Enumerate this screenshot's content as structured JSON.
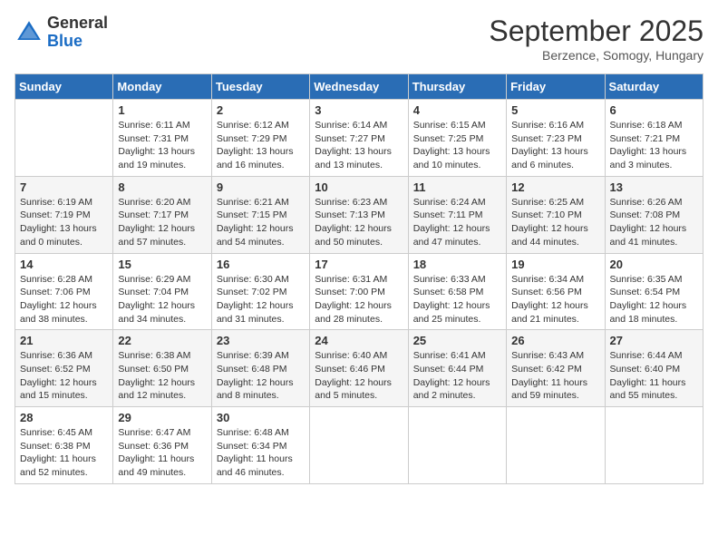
{
  "logo": {
    "general": "General",
    "blue": "Blue"
  },
  "header": {
    "month": "September 2025",
    "location": "Berzence, Somogy, Hungary"
  },
  "days_of_week": [
    "Sunday",
    "Monday",
    "Tuesday",
    "Wednesday",
    "Thursday",
    "Friday",
    "Saturday"
  ],
  "weeks": [
    [
      {
        "day": null
      },
      {
        "day": 1,
        "sunrise": "Sunrise: 6:11 AM",
        "sunset": "Sunset: 7:31 PM",
        "daylight": "Daylight: 13 hours and 19 minutes."
      },
      {
        "day": 2,
        "sunrise": "Sunrise: 6:12 AM",
        "sunset": "Sunset: 7:29 PM",
        "daylight": "Daylight: 13 hours and 16 minutes."
      },
      {
        "day": 3,
        "sunrise": "Sunrise: 6:14 AM",
        "sunset": "Sunset: 7:27 PM",
        "daylight": "Daylight: 13 hours and 13 minutes."
      },
      {
        "day": 4,
        "sunrise": "Sunrise: 6:15 AM",
        "sunset": "Sunset: 7:25 PM",
        "daylight": "Daylight: 13 hours and 10 minutes."
      },
      {
        "day": 5,
        "sunrise": "Sunrise: 6:16 AM",
        "sunset": "Sunset: 7:23 PM",
        "daylight": "Daylight: 13 hours and 6 minutes."
      },
      {
        "day": 6,
        "sunrise": "Sunrise: 6:18 AM",
        "sunset": "Sunset: 7:21 PM",
        "daylight": "Daylight: 13 hours and 3 minutes."
      }
    ],
    [
      {
        "day": 7,
        "sunrise": "Sunrise: 6:19 AM",
        "sunset": "Sunset: 7:19 PM",
        "daylight": "Daylight: 13 hours and 0 minutes."
      },
      {
        "day": 8,
        "sunrise": "Sunrise: 6:20 AM",
        "sunset": "Sunset: 7:17 PM",
        "daylight": "Daylight: 12 hours and 57 minutes."
      },
      {
        "day": 9,
        "sunrise": "Sunrise: 6:21 AM",
        "sunset": "Sunset: 7:15 PM",
        "daylight": "Daylight: 12 hours and 54 minutes."
      },
      {
        "day": 10,
        "sunrise": "Sunrise: 6:23 AM",
        "sunset": "Sunset: 7:13 PM",
        "daylight": "Daylight: 12 hours and 50 minutes."
      },
      {
        "day": 11,
        "sunrise": "Sunrise: 6:24 AM",
        "sunset": "Sunset: 7:11 PM",
        "daylight": "Daylight: 12 hours and 47 minutes."
      },
      {
        "day": 12,
        "sunrise": "Sunrise: 6:25 AM",
        "sunset": "Sunset: 7:10 PM",
        "daylight": "Daylight: 12 hours and 44 minutes."
      },
      {
        "day": 13,
        "sunrise": "Sunrise: 6:26 AM",
        "sunset": "Sunset: 7:08 PM",
        "daylight": "Daylight: 12 hours and 41 minutes."
      }
    ],
    [
      {
        "day": 14,
        "sunrise": "Sunrise: 6:28 AM",
        "sunset": "Sunset: 7:06 PM",
        "daylight": "Daylight: 12 hours and 38 minutes."
      },
      {
        "day": 15,
        "sunrise": "Sunrise: 6:29 AM",
        "sunset": "Sunset: 7:04 PM",
        "daylight": "Daylight: 12 hours and 34 minutes."
      },
      {
        "day": 16,
        "sunrise": "Sunrise: 6:30 AM",
        "sunset": "Sunset: 7:02 PM",
        "daylight": "Daylight: 12 hours and 31 minutes."
      },
      {
        "day": 17,
        "sunrise": "Sunrise: 6:31 AM",
        "sunset": "Sunset: 7:00 PM",
        "daylight": "Daylight: 12 hours and 28 minutes."
      },
      {
        "day": 18,
        "sunrise": "Sunrise: 6:33 AM",
        "sunset": "Sunset: 6:58 PM",
        "daylight": "Daylight: 12 hours and 25 minutes."
      },
      {
        "day": 19,
        "sunrise": "Sunrise: 6:34 AM",
        "sunset": "Sunset: 6:56 PM",
        "daylight": "Daylight: 12 hours and 21 minutes."
      },
      {
        "day": 20,
        "sunrise": "Sunrise: 6:35 AM",
        "sunset": "Sunset: 6:54 PM",
        "daylight": "Daylight: 12 hours and 18 minutes."
      }
    ],
    [
      {
        "day": 21,
        "sunrise": "Sunrise: 6:36 AM",
        "sunset": "Sunset: 6:52 PM",
        "daylight": "Daylight: 12 hours and 15 minutes."
      },
      {
        "day": 22,
        "sunrise": "Sunrise: 6:38 AM",
        "sunset": "Sunset: 6:50 PM",
        "daylight": "Daylight: 12 hours and 12 minutes."
      },
      {
        "day": 23,
        "sunrise": "Sunrise: 6:39 AM",
        "sunset": "Sunset: 6:48 PM",
        "daylight": "Daylight: 12 hours and 8 minutes."
      },
      {
        "day": 24,
        "sunrise": "Sunrise: 6:40 AM",
        "sunset": "Sunset: 6:46 PM",
        "daylight": "Daylight: 12 hours and 5 minutes."
      },
      {
        "day": 25,
        "sunrise": "Sunrise: 6:41 AM",
        "sunset": "Sunset: 6:44 PM",
        "daylight": "Daylight: 12 hours and 2 minutes."
      },
      {
        "day": 26,
        "sunrise": "Sunrise: 6:43 AM",
        "sunset": "Sunset: 6:42 PM",
        "daylight": "Daylight: 11 hours and 59 minutes."
      },
      {
        "day": 27,
        "sunrise": "Sunrise: 6:44 AM",
        "sunset": "Sunset: 6:40 PM",
        "daylight": "Daylight: 11 hours and 55 minutes."
      }
    ],
    [
      {
        "day": 28,
        "sunrise": "Sunrise: 6:45 AM",
        "sunset": "Sunset: 6:38 PM",
        "daylight": "Daylight: 11 hours and 52 minutes."
      },
      {
        "day": 29,
        "sunrise": "Sunrise: 6:47 AM",
        "sunset": "Sunset: 6:36 PM",
        "daylight": "Daylight: 11 hours and 49 minutes."
      },
      {
        "day": 30,
        "sunrise": "Sunrise: 6:48 AM",
        "sunset": "Sunset: 6:34 PM",
        "daylight": "Daylight: 11 hours and 46 minutes."
      },
      {
        "day": null
      },
      {
        "day": null
      },
      {
        "day": null
      },
      {
        "day": null
      }
    ]
  ]
}
